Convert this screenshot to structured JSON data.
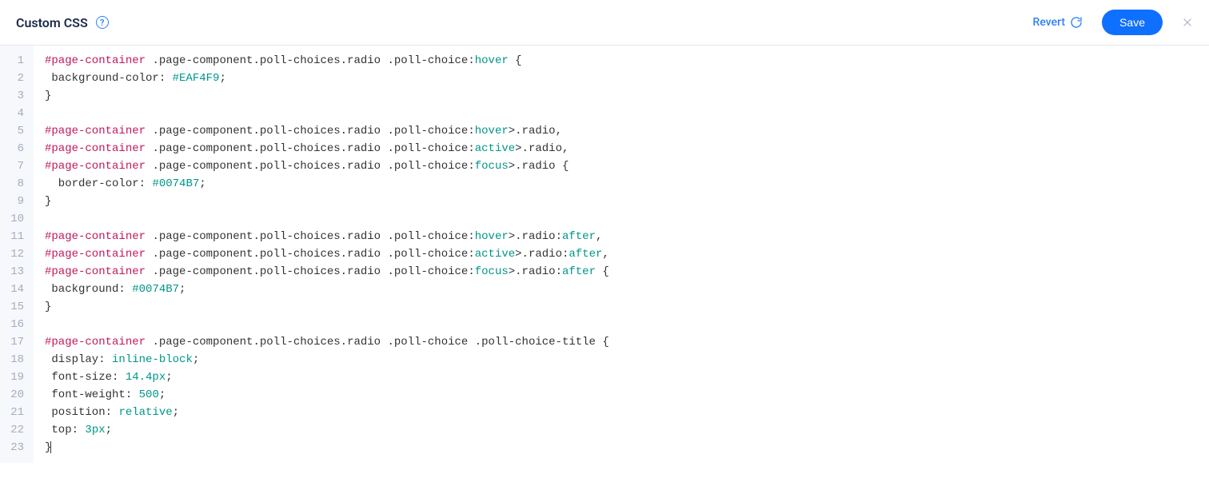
{
  "header": {
    "title": "Custom CSS",
    "help_glyph": "?",
    "revert_label": "Revert",
    "save_label": "Save"
  },
  "editor": {
    "line_start": 1,
    "line_count": 23,
    "lines": [
      [
        {
          "t": "#page-container",
          "c": "tk-sel-id"
        },
        {
          "t": " ",
          "c": ""
        },
        {
          "t": ".page-component.poll-choices.radio",
          "c": "tk-sel-cls"
        },
        {
          "t": " ",
          "c": ""
        },
        {
          "t": ".poll-choice",
          "c": "tk-sel-cls"
        },
        {
          "t": ":",
          "c": "tk-punc"
        },
        {
          "t": "hover",
          "c": "tk-pseudo"
        },
        {
          "t": " {",
          "c": "tk-punc"
        }
      ],
      [
        {
          "t": " background-color",
          "c": "tk-prop"
        },
        {
          "t": ": ",
          "c": "tk-punc"
        },
        {
          "t": "#EAF4F9",
          "c": "tk-value"
        },
        {
          "t": ";",
          "c": "tk-punc"
        }
      ],
      [
        {
          "t": "}",
          "c": "tk-punc"
        }
      ],
      [],
      [
        {
          "t": "#page-container",
          "c": "tk-sel-id"
        },
        {
          "t": " ",
          "c": ""
        },
        {
          "t": ".page-component.poll-choices.radio",
          "c": "tk-sel-cls"
        },
        {
          "t": " ",
          "c": ""
        },
        {
          "t": ".poll-choice",
          "c": "tk-sel-cls"
        },
        {
          "t": ":",
          "c": "tk-punc"
        },
        {
          "t": "hover",
          "c": "tk-pseudo"
        },
        {
          "t": ">.radio",
          "c": "tk-sel-cls"
        },
        {
          "t": ",",
          "c": "tk-punc"
        }
      ],
      [
        {
          "t": "#page-container",
          "c": "tk-sel-id"
        },
        {
          "t": " ",
          "c": ""
        },
        {
          "t": ".page-component.poll-choices.radio",
          "c": "tk-sel-cls"
        },
        {
          "t": " ",
          "c": ""
        },
        {
          "t": ".poll-choice",
          "c": "tk-sel-cls"
        },
        {
          "t": ":",
          "c": "tk-punc"
        },
        {
          "t": "active",
          "c": "tk-pseudo"
        },
        {
          "t": ">.radio",
          "c": "tk-sel-cls"
        },
        {
          "t": ",",
          "c": "tk-punc"
        }
      ],
      [
        {
          "t": "#page-container",
          "c": "tk-sel-id"
        },
        {
          "t": " ",
          "c": ""
        },
        {
          "t": ".page-component.poll-choices.radio",
          "c": "tk-sel-cls"
        },
        {
          "t": " ",
          "c": ""
        },
        {
          "t": ".poll-choice",
          "c": "tk-sel-cls"
        },
        {
          "t": ":",
          "c": "tk-punc"
        },
        {
          "t": "focus",
          "c": "tk-pseudo"
        },
        {
          "t": ">.radio",
          "c": "tk-sel-cls"
        },
        {
          "t": " {",
          "c": "tk-punc"
        }
      ],
      [
        {
          "t": "  border-color",
          "c": "tk-prop"
        },
        {
          "t": ": ",
          "c": "tk-punc"
        },
        {
          "t": "#0074B7",
          "c": "tk-value"
        },
        {
          "t": ";",
          "c": "tk-punc"
        }
      ],
      [
        {
          "t": "}",
          "c": "tk-punc"
        }
      ],
      [],
      [
        {
          "t": "#page-container",
          "c": "tk-sel-id"
        },
        {
          "t": " ",
          "c": ""
        },
        {
          "t": ".page-component.poll-choices.radio",
          "c": "tk-sel-cls"
        },
        {
          "t": " ",
          "c": ""
        },
        {
          "t": ".poll-choice",
          "c": "tk-sel-cls"
        },
        {
          "t": ":",
          "c": "tk-punc"
        },
        {
          "t": "hover",
          "c": "tk-pseudo"
        },
        {
          "t": ">.radio",
          "c": "tk-sel-cls"
        },
        {
          "t": ":",
          "c": "tk-punc"
        },
        {
          "t": "after",
          "c": "tk-pseudo"
        },
        {
          "t": ",",
          "c": "tk-punc"
        }
      ],
      [
        {
          "t": "#page-container",
          "c": "tk-sel-id"
        },
        {
          "t": " ",
          "c": ""
        },
        {
          "t": ".page-component.poll-choices.radio",
          "c": "tk-sel-cls"
        },
        {
          "t": " ",
          "c": ""
        },
        {
          "t": ".poll-choice",
          "c": "tk-sel-cls"
        },
        {
          "t": ":",
          "c": "tk-punc"
        },
        {
          "t": "active",
          "c": "tk-pseudo"
        },
        {
          "t": ">.radio",
          "c": "tk-sel-cls"
        },
        {
          "t": ":",
          "c": "tk-punc"
        },
        {
          "t": "after",
          "c": "tk-pseudo"
        },
        {
          "t": ",",
          "c": "tk-punc"
        }
      ],
      [
        {
          "t": "#page-container",
          "c": "tk-sel-id"
        },
        {
          "t": " ",
          "c": ""
        },
        {
          "t": ".page-component.poll-choices.radio",
          "c": "tk-sel-cls"
        },
        {
          "t": " ",
          "c": ""
        },
        {
          "t": ".poll-choice",
          "c": "tk-sel-cls"
        },
        {
          "t": ":",
          "c": "tk-punc"
        },
        {
          "t": "focus",
          "c": "tk-pseudo"
        },
        {
          "t": ">.radio",
          "c": "tk-sel-cls"
        },
        {
          "t": ":",
          "c": "tk-punc"
        },
        {
          "t": "after",
          "c": "tk-pseudo"
        },
        {
          "t": " {",
          "c": "tk-punc"
        }
      ],
      [
        {
          "t": " background",
          "c": "tk-prop"
        },
        {
          "t": ": ",
          "c": "tk-punc"
        },
        {
          "t": "#0074B7",
          "c": "tk-value"
        },
        {
          "t": ";",
          "c": "tk-punc"
        }
      ],
      [
        {
          "t": "}",
          "c": "tk-punc"
        }
      ],
      [],
      [
        {
          "t": "#page-container",
          "c": "tk-sel-id"
        },
        {
          "t": " ",
          "c": ""
        },
        {
          "t": ".page-component.poll-choices.radio",
          "c": "tk-sel-cls"
        },
        {
          "t": " ",
          "c": ""
        },
        {
          "t": ".poll-choice",
          "c": "tk-sel-cls"
        },
        {
          "t": " ",
          "c": ""
        },
        {
          "t": ".poll-choice-title",
          "c": "tk-sel-cls"
        },
        {
          "t": " {",
          "c": "tk-punc"
        }
      ],
      [
        {
          "t": " display",
          "c": "tk-prop"
        },
        {
          "t": ": ",
          "c": "tk-punc"
        },
        {
          "t": "inline-block",
          "c": "tk-value"
        },
        {
          "t": ";",
          "c": "tk-punc"
        }
      ],
      [
        {
          "t": " font-size",
          "c": "tk-prop"
        },
        {
          "t": ": ",
          "c": "tk-punc"
        },
        {
          "t": "14.4px",
          "c": "tk-value"
        },
        {
          "t": ";",
          "c": "tk-punc"
        }
      ],
      [
        {
          "t": " font-weight",
          "c": "tk-prop"
        },
        {
          "t": ": ",
          "c": "tk-punc"
        },
        {
          "t": "500",
          "c": "tk-value"
        },
        {
          "t": ";",
          "c": "tk-punc"
        }
      ],
      [
        {
          "t": " position",
          "c": "tk-prop"
        },
        {
          "t": ": ",
          "c": "tk-punc"
        },
        {
          "t": "relative",
          "c": "tk-value"
        },
        {
          "t": ";",
          "c": "tk-punc"
        }
      ],
      [
        {
          "t": " top",
          "c": "tk-prop"
        },
        {
          "t": ": ",
          "c": "tk-punc"
        },
        {
          "t": "3px",
          "c": "tk-value"
        },
        {
          "t": ";",
          "c": "tk-punc"
        }
      ],
      [
        {
          "t": "}",
          "c": "tk-punc"
        }
      ]
    ],
    "caret_line": 23
  }
}
